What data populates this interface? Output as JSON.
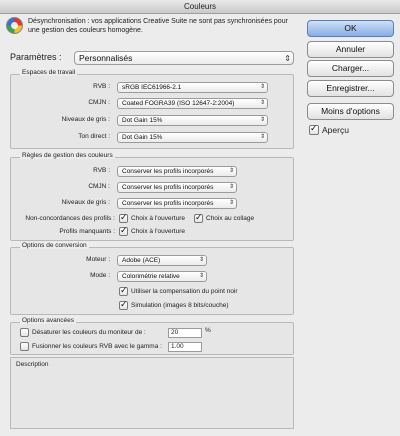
{
  "window": {
    "title": "Couleurs"
  },
  "header": {
    "info_text": "Désynchronisation : vos applications Creative Suite ne sont pas synchronisées pour une gestion des couleurs homogène."
  },
  "buttons": {
    "ok": "OK",
    "cancel": "Annuler",
    "load": "Charger...",
    "save": "Enregistrer...",
    "fewer_options": "Moins d'options"
  },
  "preview": {
    "label": "Aperçu",
    "checked": true
  },
  "settings": {
    "label": "Paramètres :",
    "value": "Personnalisés"
  },
  "working_spaces": {
    "title": "Espaces de travail",
    "rows": [
      {
        "label": "RVB :",
        "value": "sRGB IEC61966-2.1"
      },
      {
        "label": "CMJN :",
        "value": "Coated FOGRA39 (ISO 12647-2:2004)"
      },
      {
        "label": "Niveaux de gris :",
        "value": "Dot Gain 15%"
      },
      {
        "label": "Ton direct :",
        "value": "Dot Gain 15%"
      }
    ]
  },
  "policies": {
    "title": "Règles de gestion des couleurs",
    "rows": [
      {
        "label": "RVB :",
        "value": "Conserver les profils incorporés"
      },
      {
        "label": "CMJN :",
        "value": "Conserver les profils incorporés"
      },
      {
        "label": "Niveaux de gris :",
        "value": "Conserver les profils incorporés"
      }
    ],
    "mismatch_label": "Non-concordances des profils :",
    "mismatch_open": "Choix à l'ouverture",
    "mismatch_paste": "Choix au collage",
    "missing_label": "Profils manquants :",
    "missing_open": "Choix à l'ouverture"
  },
  "conversion": {
    "title": "Options de conversion",
    "engine_label": "Moteur :",
    "engine_value": "Adobe (ACE)",
    "intent_label": "Mode :",
    "intent_value": "Colorimétrie relative",
    "bpc_label": "Utiliser la compensation du point noir",
    "dither_label": "Simulation (images 8 bits/couche)"
  },
  "advanced": {
    "title": "Options avancées",
    "desaturate_label": "Désaturer les couleurs du moniteur de :",
    "desaturate_value": "20",
    "desaturate_unit": "%",
    "blend_label": "Fusionner les couleurs RVB avec le gamma :",
    "blend_value": "1.00"
  },
  "description": {
    "title": "Description"
  }
}
